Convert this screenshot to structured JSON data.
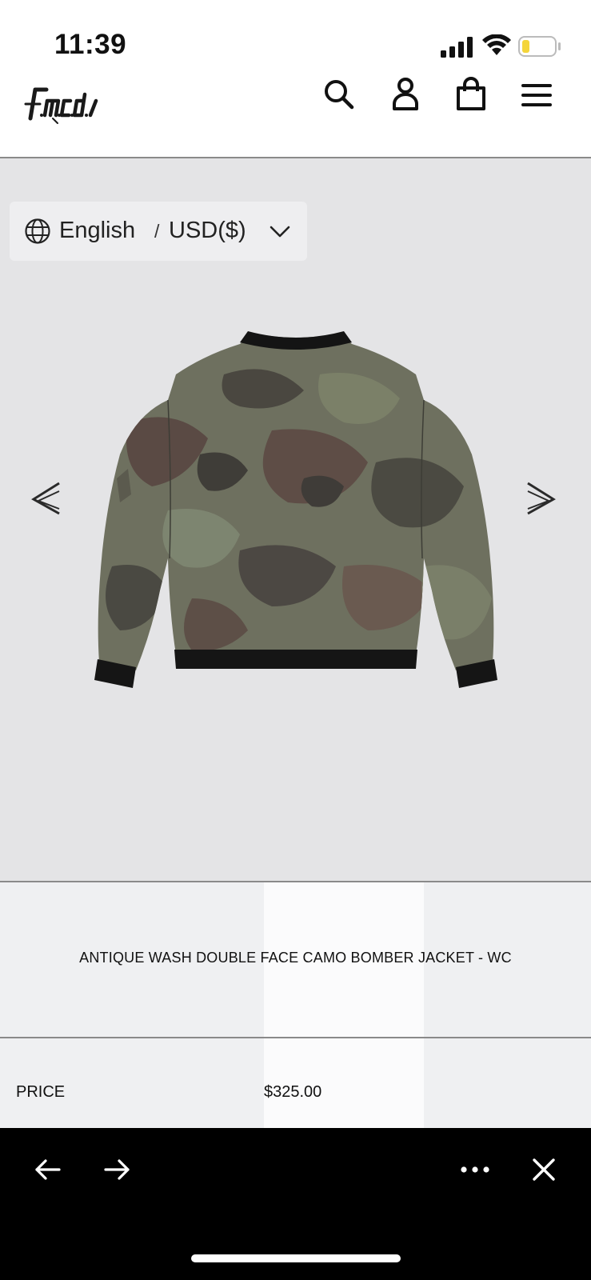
{
  "status_bar": {
    "time": "11:39",
    "icons": [
      "signal-icon",
      "wifi-icon",
      "battery-icon"
    ],
    "battery_color": "#f4d53b"
  },
  "header": {
    "logo_text": "f.m.c.d.",
    "icons": [
      "search-icon",
      "account-icon",
      "cart-icon",
      "menu-icon"
    ]
  },
  "locale": {
    "language": "English",
    "separator": "/",
    "currency": "USD($)",
    "icons": [
      "globe-icon",
      "chevron-down-icon"
    ]
  },
  "gallery": {
    "prev_icon": "chevron-left-double-icon",
    "next_icon": "chevron-right-double-icon",
    "background": "#e4e4e6"
  },
  "product": {
    "title": "ANTIQUE WASH DOUBLE FACE CAMO BOMBER JACKET - WC",
    "price_label": "PRICE",
    "price_value": "$325.00"
  },
  "browser_bar": {
    "icons": [
      "back-arrow-icon",
      "forward-arrow-icon",
      "more-icon",
      "close-icon"
    ]
  }
}
